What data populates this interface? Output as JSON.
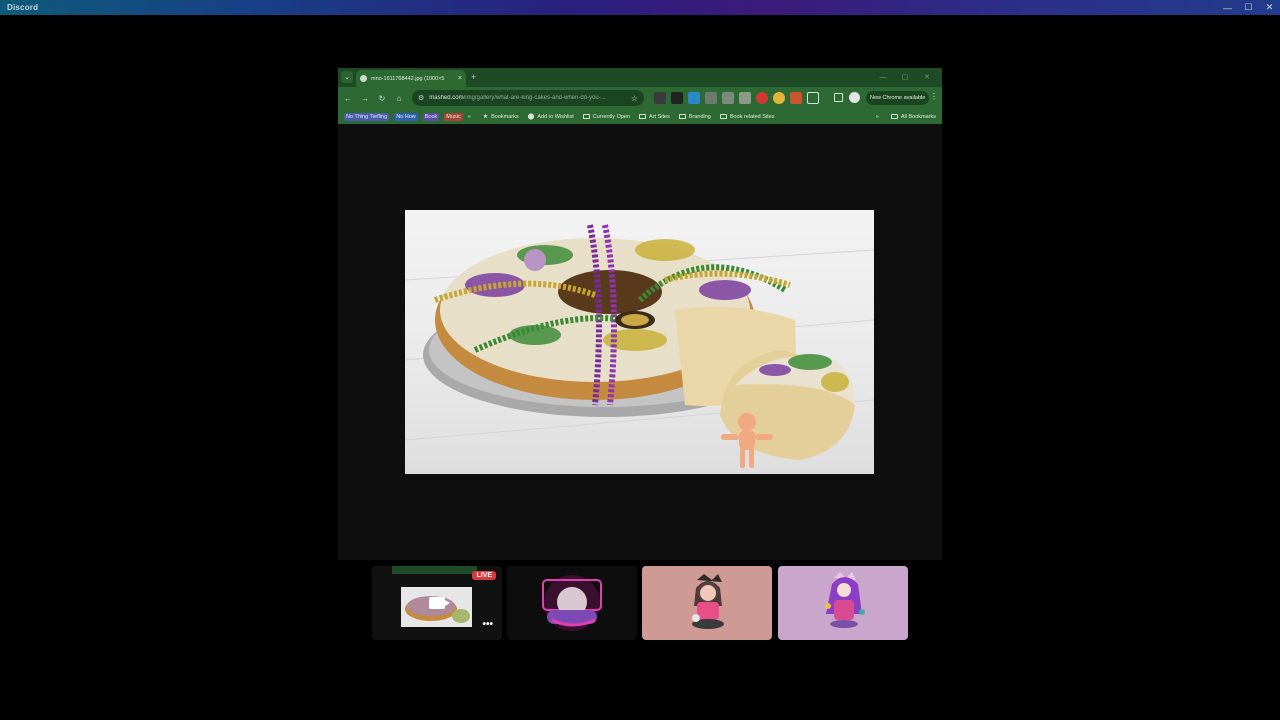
{
  "discord": {
    "app_title": "Discord",
    "window_controls": [
      "—",
      "☐",
      "✕"
    ]
  },
  "chrome": {
    "tab": {
      "title": "mno-1611768442.jpg (1000×5",
      "close": "×"
    },
    "new_tab": "+",
    "window_controls": [
      "—",
      "▢",
      "✕"
    ],
    "toolbar": {
      "back": "←",
      "forward": "→",
      "reload": "↻",
      "home": "⌂",
      "site_info": "⚙",
      "url_host": "mashed.com",
      "url_path": "/img/gallery/what-are-king-cakes-and-when-do-you-...",
      "star": "☆",
      "update_chip": "New Chrome available",
      "menu": "⋮"
    },
    "bookmarks": {
      "chips": [
        {
          "label": "No Thing Tiefling",
          "color": "#4a5bb0"
        },
        {
          "label": "No How",
          "color": "#2f5fb5"
        },
        {
          "label": "Book",
          "color": "#5c4aa8"
        },
        {
          "label": "Music",
          "color": "#a8433a"
        }
      ],
      "overflow": "»",
      "items": [
        {
          "icon": "★",
          "label": "Bookmarks"
        },
        {
          "icon": "⬤",
          "label": "Add to Wishlist"
        },
        {
          "icon": "folder",
          "label": "Currently Open"
        },
        {
          "icon": "folder",
          "label": "Art Sites"
        },
        {
          "icon": "folder",
          "label": "Branding"
        },
        {
          "icon": "folder",
          "label": "Book related Sites"
        }
      ],
      "overflow_right": "»",
      "all_bookmarks": "All Bookmarks"
    }
  },
  "participants": {
    "live_label": "LIVE",
    "more": "•••"
  }
}
